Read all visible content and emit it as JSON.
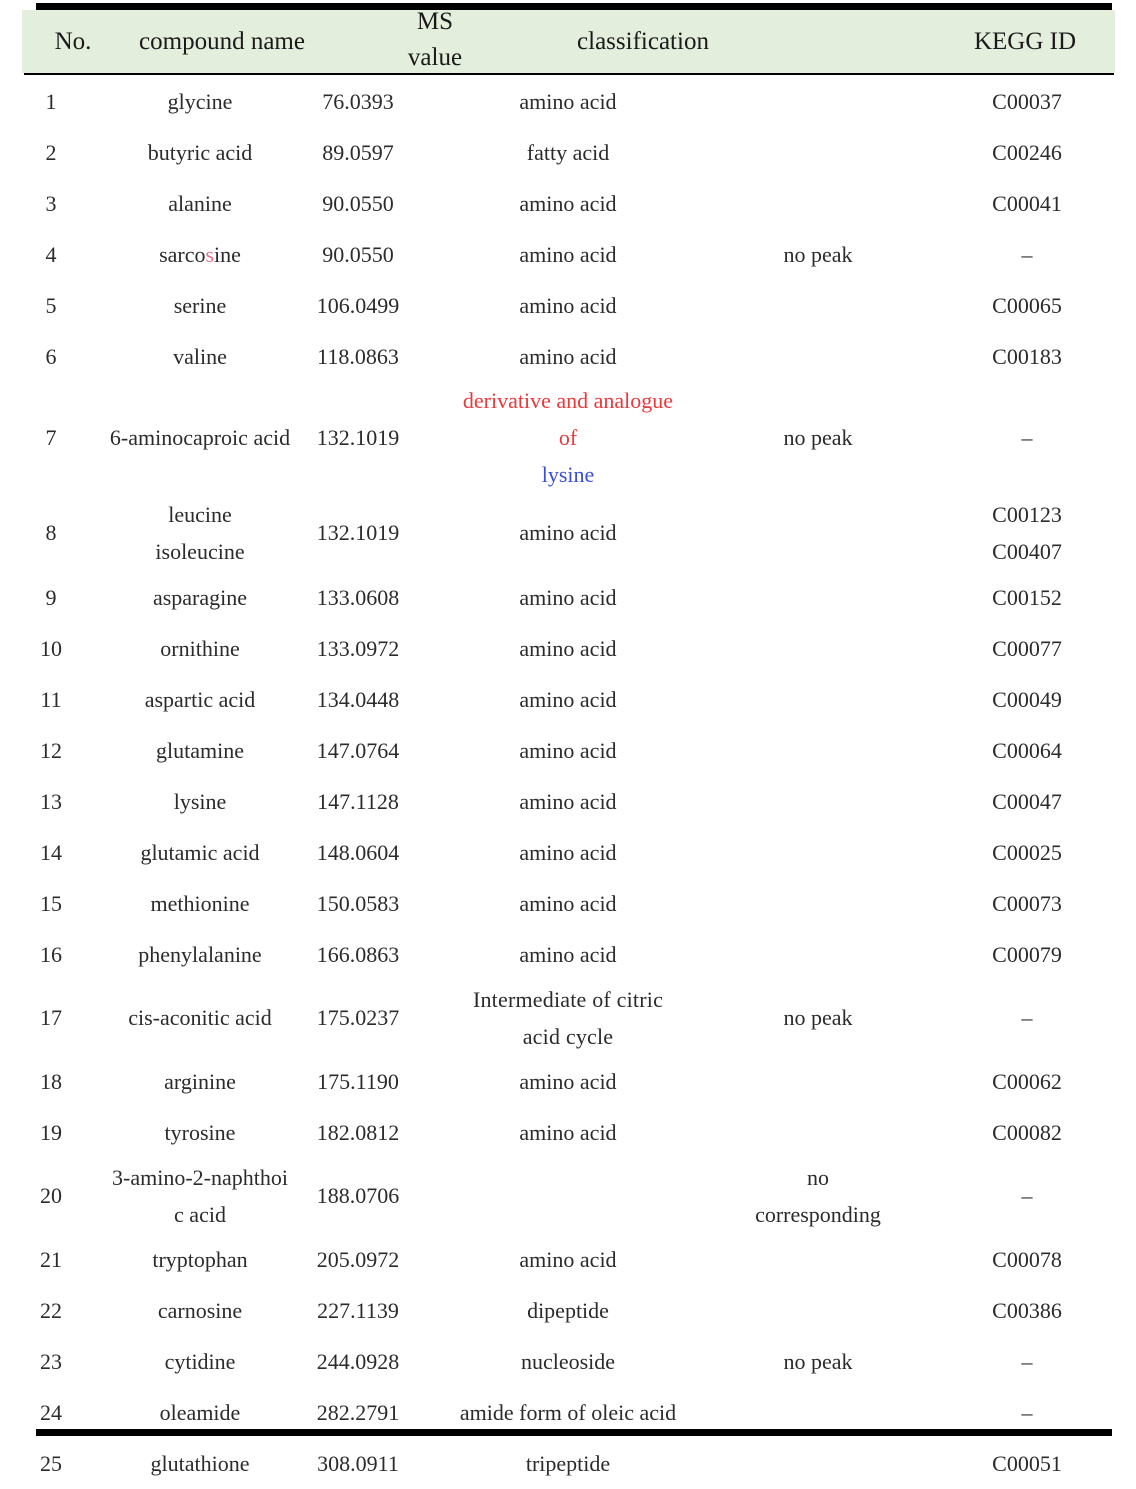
{
  "table": {
    "headers": {
      "no": "No.",
      "compound_name": "compound name",
      "ms_value_line1": "MS",
      "ms_value_line2": "value",
      "classification": "classification",
      "kegg_id": "KEGG ID"
    },
    "header_background": "#e3eedd",
    "accent_red": "#e8393c",
    "accent_blue": "#3b4fd0",
    "rows": [
      {
        "no": "1",
        "name": "glycine",
        "ms": "76.0393",
        "classification": "amino acid",
        "note": "",
        "kegg": "C00037"
      },
      {
        "no": "2",
        "name": "butyric acid",
        "ms": "89.0597",
        "classification": "fatty acid",
        "note": "",
        "kegg": "C00246"
      },
      {
        "no": "3",
        "name": "alanine",
        "ms": "90.0550",
        "classification": "amino acid",
        "note": "",
        "kegg": "C00041"
      },
      {
        "no": "4",
        "name": "sarcosine",
        "ms": "90.0550",
        "classification": "amino acid",
        "note": "no peak",
        "kegg": "–"
      },
      {
        "no": "5",
        "name": "serine",
        "ms": "106.0499",
        "classification": "amino acid",
        "note": "",
        "kegg": "C00065"
      },
      {
        "no": "6",
        "name": "valine",
        "ms": "118.0863",
        "classification": "amino acid",
        "note": "",
        "kegg": "C00183"
      },
      {
        "no": "7",
        "name": "6-aminocaproic acid",
        "ms": "132.1019",
        "classification_line1": "derivative and analogue",
        "classification_line2_a": "of ",
        "classification_line2_b": "lysine",
        "note": "no peak",
        "kegg": "–"
      },
      {
        "no": "8",
        "name_line1": "leucine",
        "name_line2": "isoleucine",
        "ms": "132.1019",
        "classification": "amino acid",
        "note": "",
        "kegg_line1": "C00123",
        "kegg_line2": "C00407"
      },
      {
        "no": "9",
        "name": "asparagine",
        "ms": "133.0608",
        "classification": "amino acid",
        "note": "",
        "kegg": "C00152"
      },
      {
        "no": "10",
        "name": "ornithine",
        "ms": "133.0972",
        "classification": "amino acid",
        "note": "",
        "kegg": "C00077"
      },
      {
        "no": "11",
        "name": "aspartic acid",
        "ms": "134.0448",
        "classification": "amino acid",
        "note": "",
        "kegg": "C00049"
      },
      {
        "no": "12",
        "name": "glutamine",
        "ms": "147.0764",
        "classification": "amino acid",
        "note": "",
        "kegg": "C00064"
      },
      {
        "no": "13",
        "name": "lysine",
        "ms": "147.1128",
        "classification": "amino acid",
        "note": "",
        "kegg": "C00047"
      },
      {
        "no": "14",
        "name": "glutamic acid",
        "ms": "148.0604",
        "classification": "amino acid",
        "note": "",
        "kegg": "C00025"
      },
      {
        "no": "15",
        "name": "methionine",
        "ms": "150.0583",
        "classification": "amino acid",
        "note": "",
        "kegg": "C00073"
      },
      {
        "no": "16",
        "name": "phenylalanine",
        "ms": "166.0863",
        "classification": "amino acid",
        "note": "",
        "kegg": "C00079"
      },
      {
        "no": "17",
        "name": "cis-aconitic acid",
        "ms": "175.0237",
        "classification_line1": "Intermediate of   citric",
        "classification_line2": "acid cycle",
        "note": "no peak",
        "kegg": "–"
      },
      {
        "no": "18",
        "name": "arginine",
        "ms": "175.1190",
        "classification": "amino acid",
        "note": "",
        "kegg": "C00062"
      },
      {
        "no": "19",
        "name": "tyrosine",
        "ms": "182.0812",
        "classification": "amino acid",
        "note": "",
        "kegg": "C00082"
      },
      {
        "no": "20",
        "name_line1": "3-amino-2-naphthoi",
        "name_line2": "c acid",
        "ms": "188.0706",
        "classification": "",
        "note_line1": "no",
        "note_line2": "corresponding",
        "kegg": "–"
      },
      {
        "no": "21",
        "name": "tryptophan",
        "ms": "205.0972",
        "classification": "amino acid",
        "note": "",
        "kegg": "C00078"
      },
      {
        "no": "22",
        "name": "carnosine",
        "ms": "227.1139",
        "classification": "dipeptide",
        "note": "",
        "kegg": "C00386"
      },
      {
        "no": "23",
        "name": "cytidine",
        "ms": "244.0928",
        "classification": "nucleoside",
        "note": "no peak",
        "kegg": "–"
      },
      {
        "no": "24",
        "name": "oleamide",
        "ms": "282.2791",
        "classification": "amide form of oleic acid",
        "note": "",
        "kegg": "–"
      },
      {
        "no": "25",
        "name": "glutathione",
        "ms": "308.0911",
        "classification": "tripeptide",
        "note": "",
        "kegg": "C00051"
      }
    ]
  }
}
